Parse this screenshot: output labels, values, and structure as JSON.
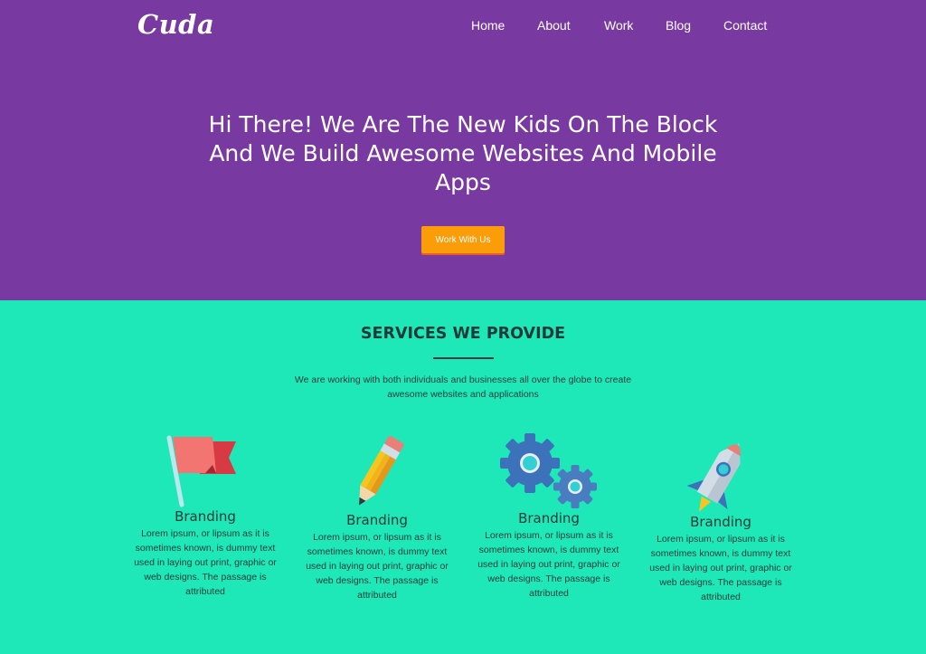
{
  "header": {
    "logo": "Cuda",
    "nav": [
      "Home",
      "About",
      "Work",
      "Blog",
      "Contact"
    ]
  },
  "hero": {
    "title": "Hi There! We Are The New Kids On The Block And We Build Awesome Websites And Mobile Apps",
    "cta_label": "Work With Us"
  },
  "services": {
    "title": "SERVICES WE PROVIDE",
    "subtitle": "We are working with both individuals and businesses all over the globe to create awesome websites and applications",
    "items": [
      {
        "icon": "flag-icon",
        "title": "Branding",
        "text": "Lorem ipsum, or lipsum as it is sometimes known, is dummy text used in laying out print, graphic or web designs. The passage is attributed"
      },
      {
        "icon": "pencil-icon",
        "title": "Branding",
        "text": "Lorem ipsum, or lipsum as it is sometimes known, is dummy text used in laying out print, graphic or web designs. The passage is attributed"
      },
      {
        "icon": "gears-icon",
        "title": "Branding",
        "text": "Lorem ipsum, or lipsum as it is sometimes known, is dummy text used in laying out print, graphic or web designs. The passage is attributed"
      },
      {
        "icon": "rocket-icon",
        "title": "Branding",
        "text": "Lorem ipsum, or lipsum as it is sometimes known, is dummy text used in laying out print, graphic or web designs. The passage is attributed"
      }
    ]
  },
  "colors": {
    "hero_bg": "#783aa0",
    "services_bg": "#1ee8b8",
    "cta": "#fb9d08",
    "text_dark": "#1d3a3a"
  }
}
